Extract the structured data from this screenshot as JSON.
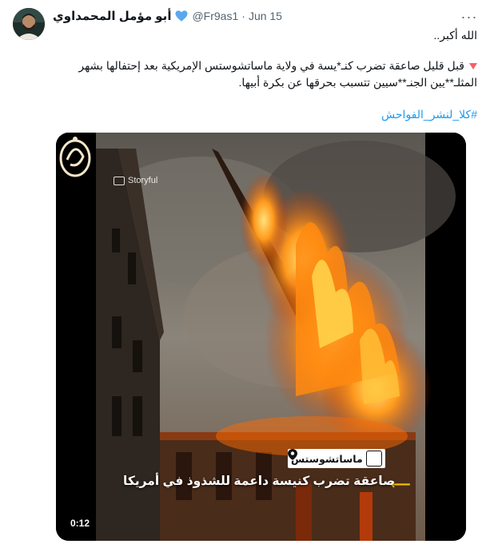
{
  "tweet": {
    "author_name": "أبو مؤمل المحمداوي",
    "handle": "@Fr9as1",
    "separator": "·",
    "date": "Jun 15",
    "more_label": "···",
    "line1": "الله أكبر..",
    "line2": "قبل قليل صاعقة تضرب كنـ*يسة في ولاية ماساتشوستس الإمريكية بعد إحتفالها بشهر المثلـ**يين الجنـ**سيين تتسبب بحرقها عن بكرة أبيها.",
    "hashtag": "#كلا_لنشر_الفواحش"
  },
  "video": {
    "watermark": "Storyful",
    "location_label": "ماساتشوستس",
    "caption": "صاعقة تضرب كنيسة داعمة للشذوذ في أمريكا",
    "arrow": "⟵",
    "duration": "0:12"
  },
  "colors": {
    "verified": "#1d9bf0",
    "hashtag": "#1d9bf0",
    "triangle": "#f4606c",
    "arrow": "#f5c400"
  }
}
